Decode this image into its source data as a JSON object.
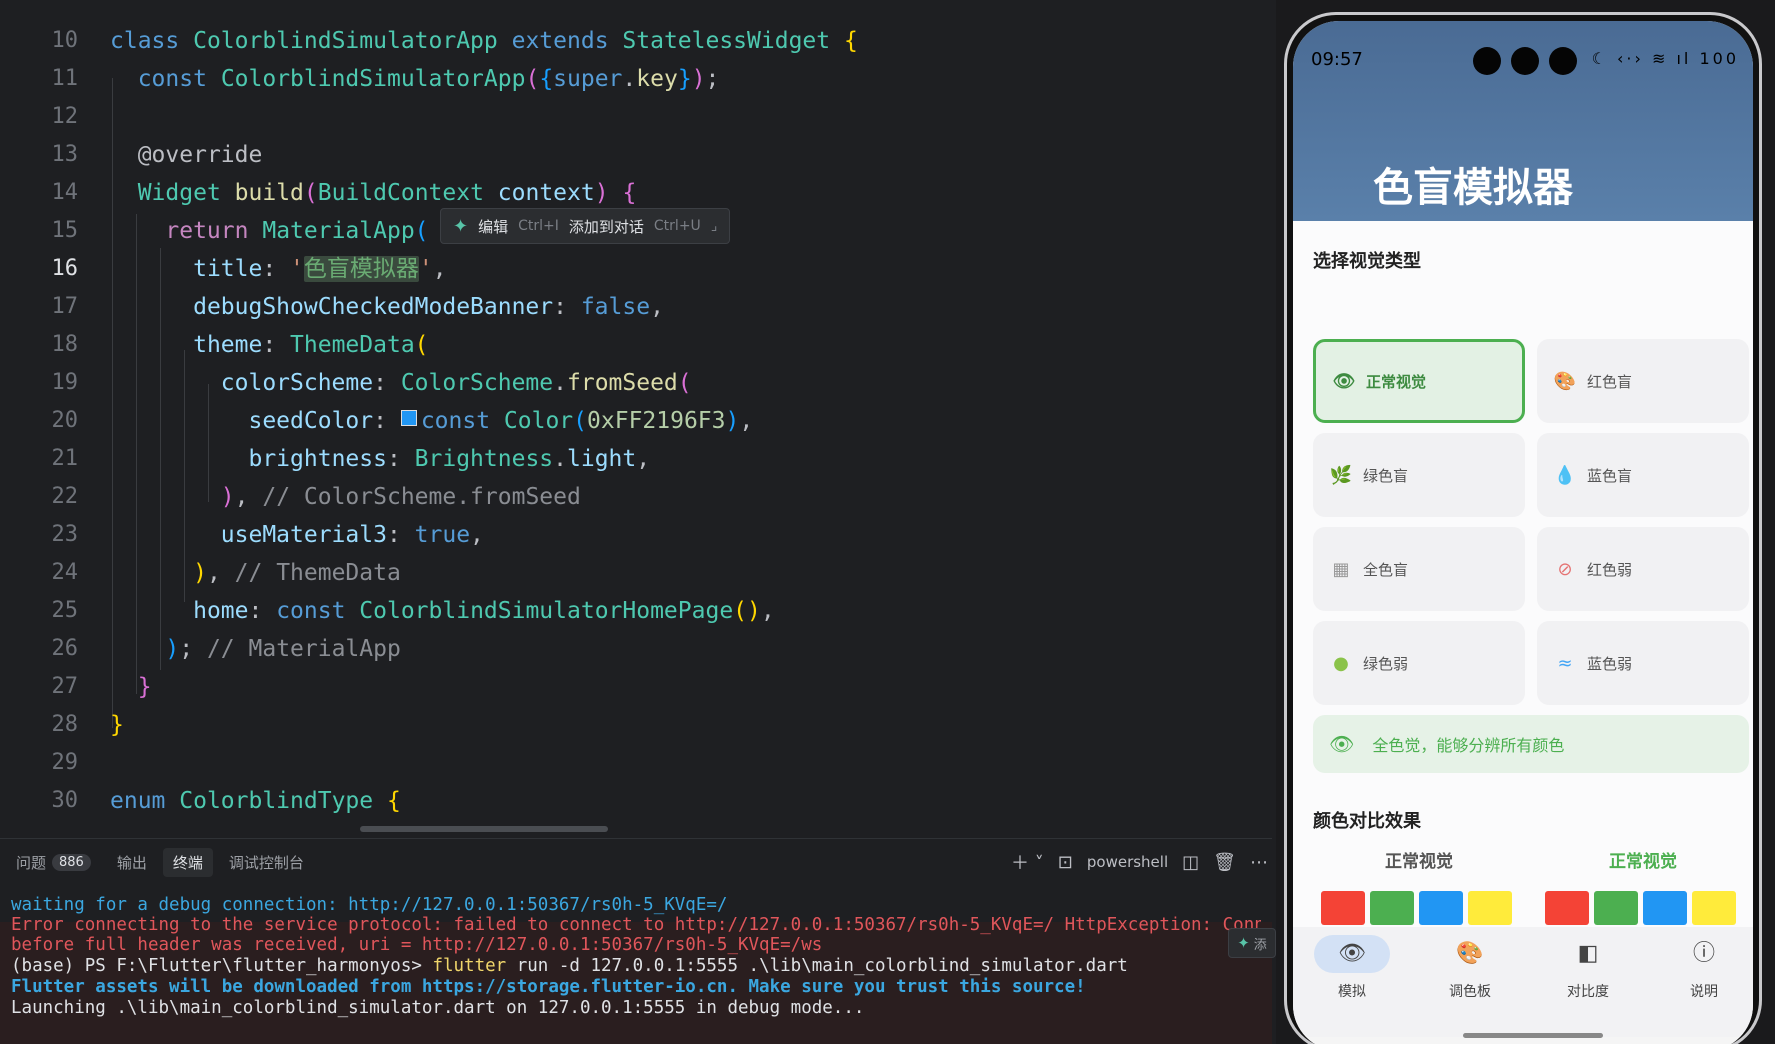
{
  "editor": {
    "lines": [
      {
        "n": "10"
      },
      {
        "n": "11"
      },
      {
        "n": "12"
      },
      {
        "n": "13"
      },
      {
        "n": "14"
      },
      {
        "n": "15"
      },
      {
        "n": "16"
      },
      {
        "n": "17"
      },
      {
        "n": "18"
      },
      {
        "n": "19"
      },
      {
        "n": "20"
      },
      {
        "n": "21"
      },
      {
        "n": "22"
      },
      {
        "n": "23"
      },
      {
        "n": "24"
      },
      {
        "n": "25"
      },
      {
        "n": "26"
      },
      {
        "n": "27"
      },
      {
        "n": "28"
      },
      {
        "n": "29"
      },
      {
        "n": "30"
      }
    ],
    "code": {
      "l10": {
        "a": "class",
        "b": "ColorblindSimulatorApp",
        "c": "extends",
        "d": "StatelessWidget",
        "e": "{"
      },
      "l11": {
        "a": "const",
        "b": "ColorblindSimulatorApp",
        "c": "(",
        "d": "{",
        "e": "super",
        "f": ".",
        "g": "key",
        "h": "}",
        "i": ")",
        "j": ";"
      },
      "l13": {
        "a": "@override"
      },
      "l14": {
        "a": "Widget",
        "b": "build",
        "c": "(",
        "d": "BuildContext",
        "e": "context",
        "f": ")",
        "g": "{"
      },
      "l15": {
        "a": "return",
        "b": "MaterialApp",
        "c": "("
      },
      "l16": {
        "a": "title",
        "b": ": ",
        "c": "'",
        "d": "色盲模拟器",
        "e": "'",
        "f": ","
      },
      "l17": {
        "a": "debugShowCheckedModeBanner",
        "b": ": ",
        "c": "false",
        "d": ","
      },
      "l18": {
        "a": "theme",
        "b": ": ",
        "c": "ThemeData",
        "d": "("
      },
      "l19": {
        "a": "colorScheme",
        "b": ": ",
        "c": "ColorScheme",
        "d": ".",
        "e": "fromSeed",
        "f": "("
      },
      "l20": {
        "a": "seedColor",
        "b": ": ",
        "c": "const",
        "d": "Color",
        "e": "(",
        "f": "0xFF2196F3",
        "g": ")",
        "h": ","
      },
      "l21": {
        "a": "brightness",
        "b": ": ",
        "c": "Brightness",
        "d": ".",
        "e": "light",
        "f": ","
      },
      "l22": {
        "a": ")",
        "b": ", ",
        "c": "// ColorScheme.fromSeed"
      },
      "l23": {
        "a": "useMaterial3",
        "b": ": ",
        "c": "true",
        "d": ","
      },
      "l24": {
        "a": ")",
        "b": ", ",
        "c": "// ThemeData"
      },
      "l25": {
        "a": "home",
        "b": ": ",
        "c": "const",
        "d": "ColorblindSimulatorHomePage",
        "e": "()",
        "f": ","
      },
      "l26": {
        "a": ")",
        "b": "; ",
        "c": "// MaterialApp"
      },
      "l27": {
        "a": "}"
      },
      "l28": {
        "a": "}"
      },
      "l30": {
        "a": "enum",
        "b": "ColorblindType",
        "c": "{"
      }
    },
    "inline_hint": {
      "edit": "编辑",
      "edit_kbd": "Ctrl+I",
      "add": "添加到对话",
      "add_kbd": "Ctrl+U"
    }
  },
  "panel": {
    "tabs": [
      {
        "label": "问题",
        "badge": "886"
      },
      {
        "label": "输出"
      },
      {
        "label": "终端"
      },
      {
        "label": "调试控制台"
      }
    ],
    "shell": "powershell",
    "terminal": [
      "waiting for a debug connection: http://127.0.0.1:50367/rs0h-5_KVqE=/",
      "Error connecting to the service protocol: failed to connect to http://127.0.0.1:50367/rs0h-5_KVqE=/ HttpException: Connect",
      "before full header was received, uri = http://127.0.0.1:50367/rs0h-5_KVqE=/ws",
      "(base) PS F:\\Flutter\\flutter_harmonyos> ",
      "flutter",
      " run -d 127.0.0.1:5555 .\\lib\\main_colorblind_simulator.dart",
      "Flutter assets will be downloaded from https://storage.flutter-io.cn. Make sure you trust this source!",
      "Launching .\\lib\\main_colorblind_simulator.dart on 127.0.0.1:5555 in debug mode..."
    ],
    "ai_chip": "添"
  },
  "phone": {
    "time": "09:57",
    "status_icons": "☾ ‹·› ≋ ıl 100",
    "app_title": "色盲模拟器",
    "section_title": "选择视觉类型",
    "options": [
      {
        "label": "正常视觉",
        "icon": "eye-icon",
        "glyph": "👁"
      },
      {
        "label": "红色盲",
        "icon": "palette-icon",
        "glyph": "🎨"
      },
      {
        "label": "绿色盲",
        "icon": "grass-icon",
        "glyph": "🌿"
      },
      {
        "label": "蓝色盲",
        "icon": "water-drop-icon",
        "glyph": "💧"
      },
      {
        "label": "全色盲",
        "icon": "grid-icon",
        "glyph": "▦"
      },
      {
        "label": "红色弱",
        "icon": "eye-off-icon",
        "glyph": "⊘"
      },
      {
        "label": "绿色弱",
        "icon": "tree-icon",
        "glyph": "●"
      },
      {
        "label": "蓝色弱",
        "icon": "waves-icon",
        "glyph": "≈"
      }
    ],
    "info_text": "全色觉，能够分辨所有颜色",
    "compare_title": "颜色对比效果",
    "compare_left": "正常视觉",
    "compare_right": "正常视觉",
    "swatch_colors": [
      "#f44336",
      "#4caf50",
      "#2196f3",
      "#ffeb3b"
    ],
    "accent": "#4caf50",
    "nav": [
      {
        "label": "模拟",
        "icon": "eye-icon",
        "glyph": "👁"
      },
      {
        "label": "调色板",
        "icon": "palette-icon",
        "glyph": "🎨"
      },
      {
        "label": "对比度",
        "icon": "contrast-icon",
        "glyph": "◧"
      },
      {
        "label": "说明",
        "icon": "info-icon",
        "glyph": "ⓘ"
      }
    ]
  }
}
